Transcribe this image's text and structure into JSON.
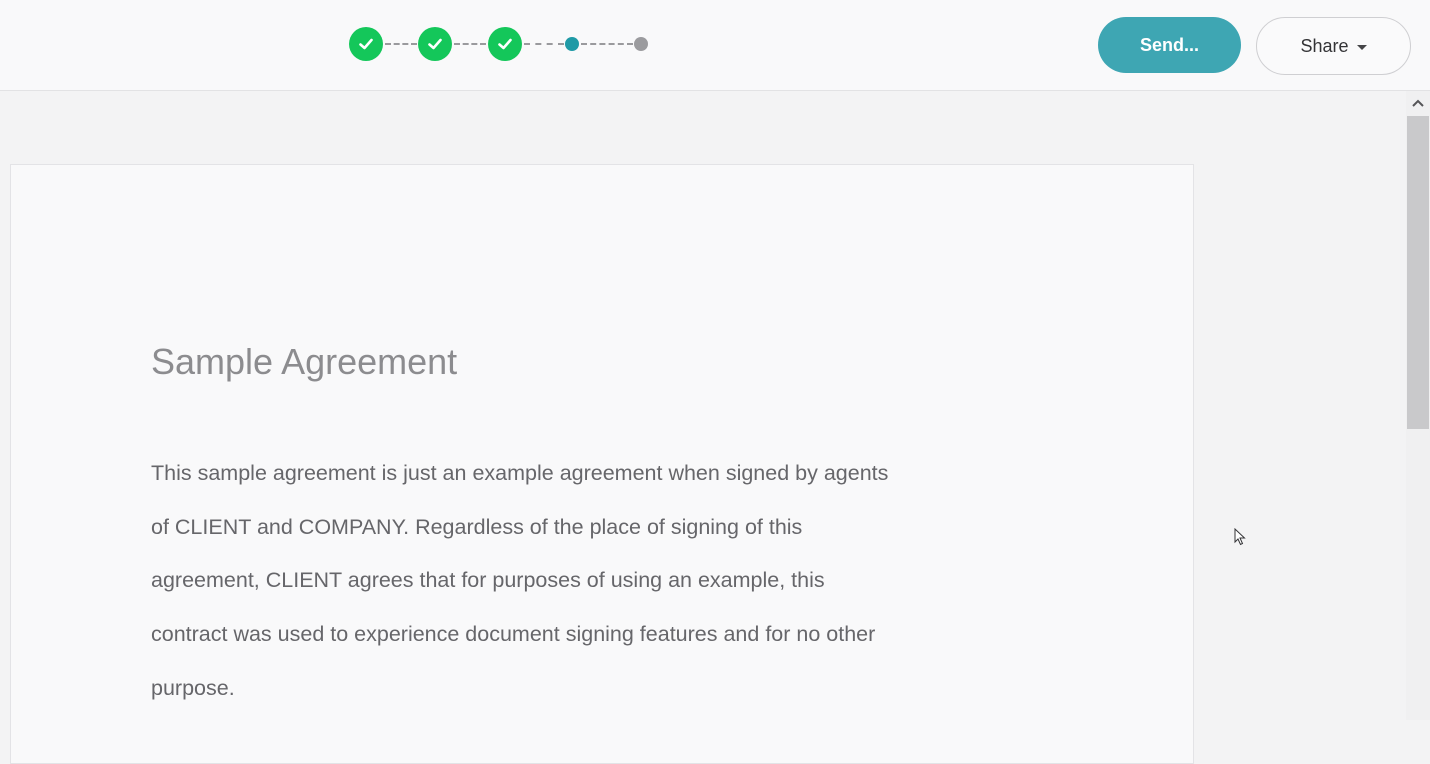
{
  "header": {
    "stepper": {
      "steps": [
        {
          "state": "completed",
          "icon": "checkmark-icon"
        },
        {
          "state": "completed",
          "icon": "checkmark-icon"
        },
        {
          "state": "completed",
          "icon": "checkmark-icon"
        },
        {
          "state": "current"
        },
        {
          "state": "pending"
        }
      ]
    },
    "send_label": "Send...",
    "share_label": "Share",
    "colors": {
      "step_completed": "#14c75a",
      "step_current": "#1f9aa6",
      "step_pending": "#9b9b9e",
      "send_button": "#3ea6b3"
    }
  },
  "document": {
    "title": "Sample Agreement",
    "body_lines": [
      "This sample agreement is just an example agreement when signed by agents",
      "of CLIENT and COMPANY. Regardless of the place of signing of this",
      "agreement, CLIENT agrees that for purposes of using an example, this",
      "contract was used to experience document signing features and for no other",
      "purpose."
    ]
  }
}
